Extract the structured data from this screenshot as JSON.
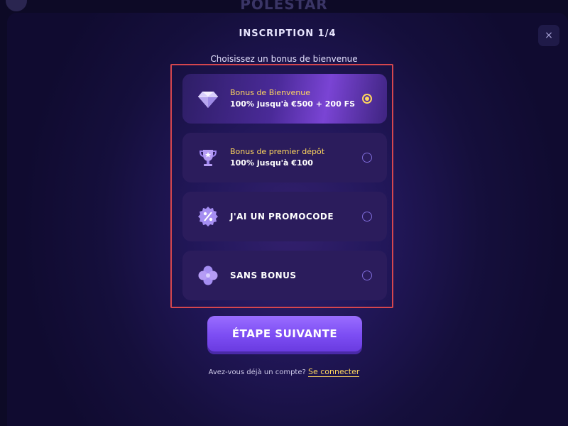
{
  "background": {
    "logo_text": "POLESTAR"
  },
  "modal": {
    "title": "INSCRIPTION 1/4",
    "close_label": "×"
  },
  "bonus_section": {
    "label": "Choisissez un bonus de bienvenue",
    "options": [
      {
        "title": "Bonus de Bienvenue",
        "subtitle": "100% jusqu'à €500 + 200 FS",
        "icon": "diamond-icon",
        "selected": true
      },
      {
        "title": "Bonus de premier dépôt",
        "subtitle": "100% jusqu'à €100",
        "icon": "trophy-icon",
        "selected": false
      },
      {
        "title": "J'AI UN PROMOCODE",
        "icon": "percent-badge-icon",
        "selected": false
      },
      {
        "title": "SANS BONUS",
        "icon": "clover-icon",
        "selected": false
      }
    ]
  },
  "next_button": {
    "label": "ÉTAPE SUIVANTE"
  },
  "login": {
    "prompt": "Avez-vous déjà un compte?",
    "link": "Se connecter"
  },
  "colors": {
    "accent": "#ffd75e",
    "button": "#7c4df3",
    "frame": "#d5464e"
  }
}
